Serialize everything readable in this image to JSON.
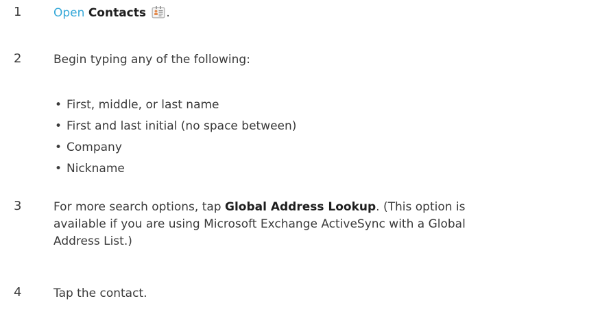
{
  "steps": [
    {
      "number": "1",
      "link_text": "Open",
      "app_name": "Contacts",
      "after_icon": "."
    },
    {
      "number": "2",
      "text": "Begin typing any of the following:",
      "bullets": [
        "First, middle, or last name",
        "First and last initial (no space between)",
        "Company",
        "Nickname"
      ]
    },
    {
      "number": "3",
      "before_bold": "For more search options, tap",
      "bold": "Global Address Lookup",
      "after_bold_line1": ". (This option is",
      "line2": "available if you are using Microsoft Exchange ActiveSync with a Global",
      "line3": "Address List.)"
    },
    {
      "number": "4",
      "text": "Tap the contact."
    }
  ],
  "icons": {
    "contacts": "contacts-app-icon",
    "bullet": "bullet-dot"
  },
  "colors": {
    "link": "#35a8d8",
    "text": "#3a3a3a",
    "bold": "#1e1e1e"
  }
}
